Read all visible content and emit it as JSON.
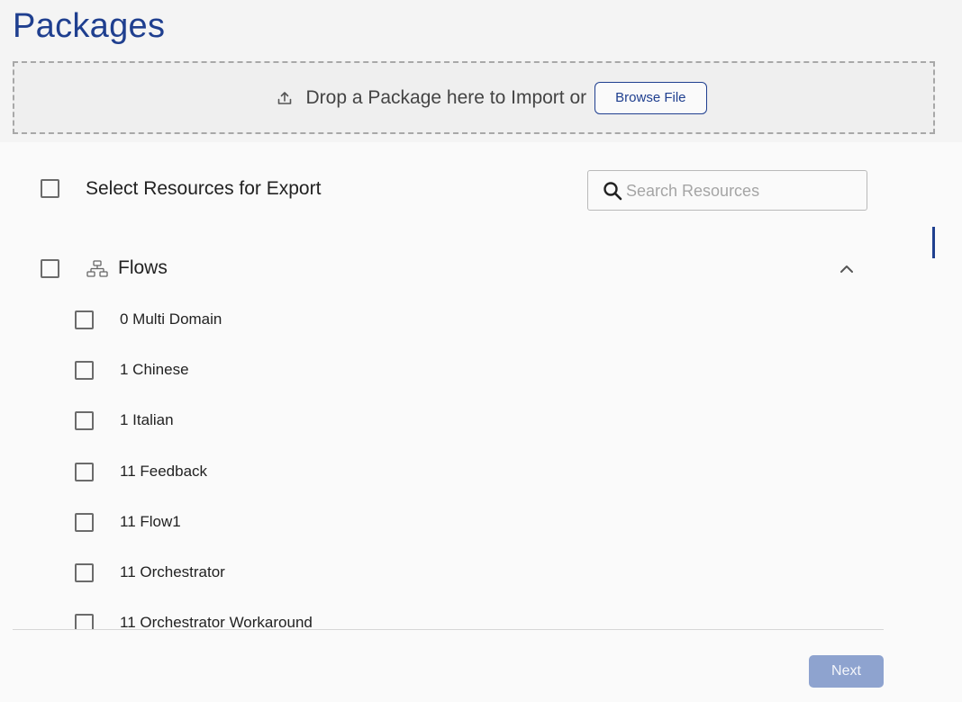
{
  "page": {
    "title": "Packages"
  },
  "dropzone": {
    "text": "Drop a Package here to Import or",
    "browse_label": "Browse File",
    "icon": "upload-icon"
  },
  "export": {
    "select_all_label": "Select Resources for Export"
  },
  "search": {
    "placeholder": "Search Resources",
    "value": "",
    "icon": "search-icon"
  },
  "section": {
    "label": "Flows",
    "icon": "flow-icon",
    "expanded": true
  },
  "items": [
    {
      "label": "0 Multi Domain"
    },
    {
      "label": "1 Chinese"
    },
    {
      "label": "1 Italian"
    },
    {
      "label": "11 Feedback"
    },
    {
      "label": "11 Flow1"
    },
    {
      "label": "11 Orchestrator"
    },
    {
      "label": "11 Orchestrator Workaround"
    }
  ],
  "footer": {
    "next_label": "Next"
  },
  "colors": {
    "accent": "#1f3f8f",
    "next_disabled": "#8ea3cf"
  }
}
